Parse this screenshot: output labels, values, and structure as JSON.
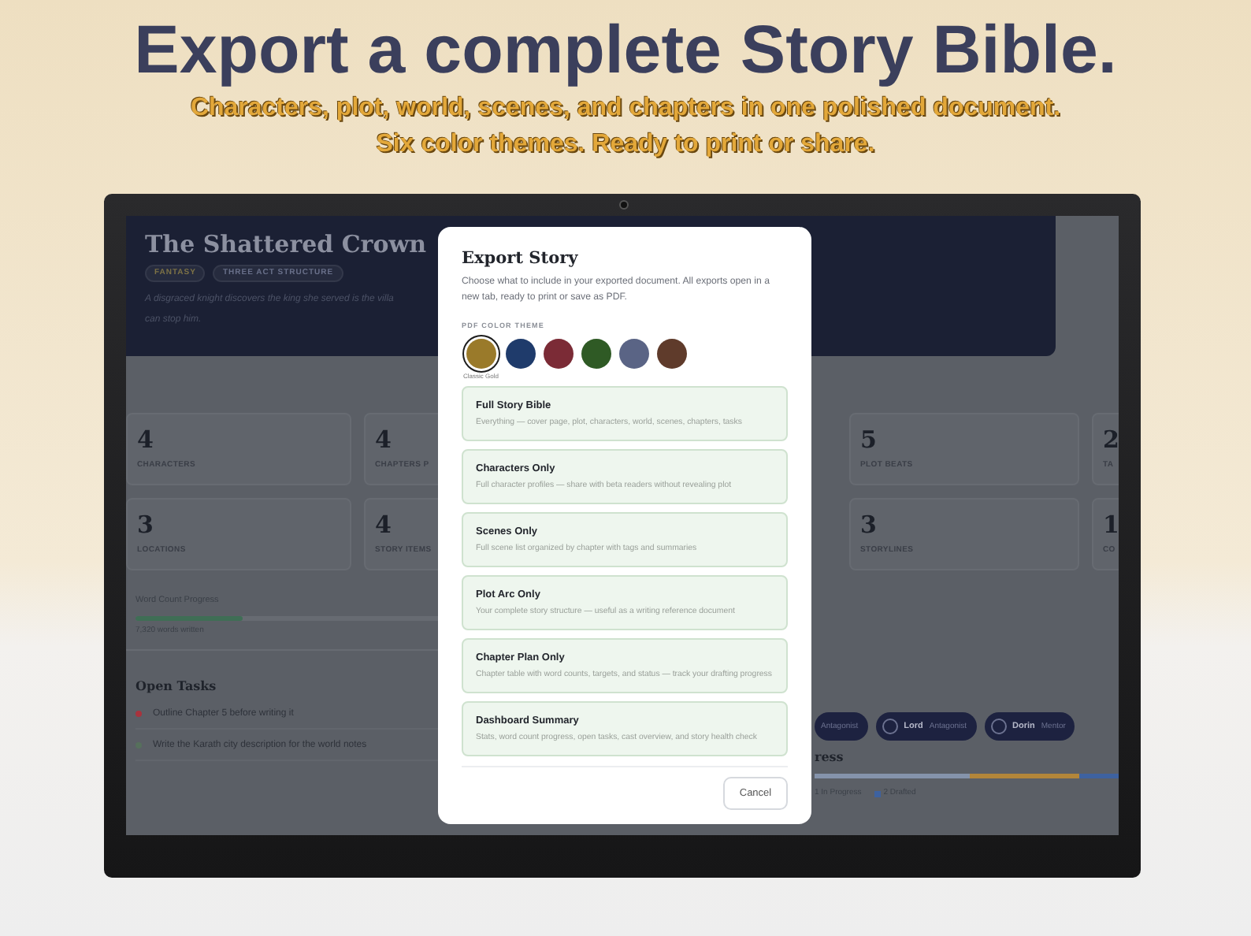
{
  "banner": {
    "title": "Export a complete Story Bible.",
    "subtitle_lines": [
      "Characters, plot, world, scenes, and chapters in one polished document.",
      "Six color themes. Ready to print or share."
    ]
  },
  "dashboard": {
    "story_title": "The Shattered Crown",
    "tags": [
      {
        "label": "FANTASY",
        "color": "#7d7246"
      },
      {
        "label": "THREE ACT STRUCTURE",
        "color": "#69708a"
      }
    ],
    "logline_lines": [
      "A disgraced knight discovers the king she served is the villa",
      "can stop him."
    ],
    "stat_rows": [
      [
        {
          "value": "4",
          "label": "CHARACTERS"
        },
        {
          "value": "4",
          "label": "CHAPTERS P"
        },
        {
          "value": "5",
          "label": "PLOT BEATS"
        },
        {
          "value": "2",
          "label": "TA"
        }
      ],
      [
        {
          "value": "3",
          "label": "LOCATIONS"
        },
        {
          "value": "4",
          "label": "STORY ITEMS"
        },
        {
          "value": "3",
          "label": "STORYLINES"
        },
        {
          "value": "1",
          "label": "CO"
        }
      ]
    ],
    "word_count": {
      "label": "Word Count Progress",
      "level": 0.27,
      "text": "7,320 words written"
    },
    "open_tasks": {
      "title": "Open Tasks",
      "items": [
        {
          "text": "Outline Chapter 5 before writing it",
          "color": "#a8333d"
        },
        {
          "text": "Write the Karath city description for the world notes",
          "color": "#56705c"
        }
      ]
    },
    "cast": [
      {
        "role": "Antagonist"
      },
      {
        "name": "Lord",
        "role": "Antagonist"
      },
      {
        "name": "Dorin",
        "role": "Mentor"
      }
    ],
    "progress": {
      "title": "ress",
      "legend": [
        {
          "text": "1 In Progress"
        },
        {
          "text": "2 Drafted",
          "color": "#3e62a0"
        }
      ]
    }
  },
  "modal": {
    "title": "Export Story",
    "description": "Choose what to include in your exported document. All exports open in a new tab, ready to print or save as PDF.",
    "theme_label": "PDF COLOR THEME",
    "themes": [
      {
        "color": "#9a7a2a",
        "selected": true
      },
      {
        "color": "#1f3b6b",
        "selected": false
      },
      {
        "color": "#7b2b36",
        "selected": false
      },
      {
        "color": "#2f5a25",
        "selected": false
      },
      {
        "color": "#5a6485",
        "selected": false
      },
      {
        "color": "#5f3b2b",
        "selected": false
      }
    ],
    "selected_theme_label": "Classic Gold",
    "options": [
      {
        "title": "Full Story Bible",
        "description": "Everything — cover page, plot, characters, world, scenes, chapters, tasks"
      },
      {
        "title": "Characters Only",
        "description": "Full character profiles — share with beta readers without revealing plot"
      },
      {
        "title": "Scenes Only",
        "description": "Full scene list organized by chapter with tags and summaries"
      },
      {
        "title": "Plot Arc Only",
        "description": "Your complete story structure — useful as a writing reference document"
      },
      {
        "title": "Chapter Plan Only",
        "description": "Chapter table with word counts, targets, and status — track your drafting progress"
      },
      {
        "title": "Dashboard Summary",
        "description": "Stats, word count progress, open tasks, cast overview, and story health check"
      }
    ],
    "cancel": "Cancel"
  }
}
